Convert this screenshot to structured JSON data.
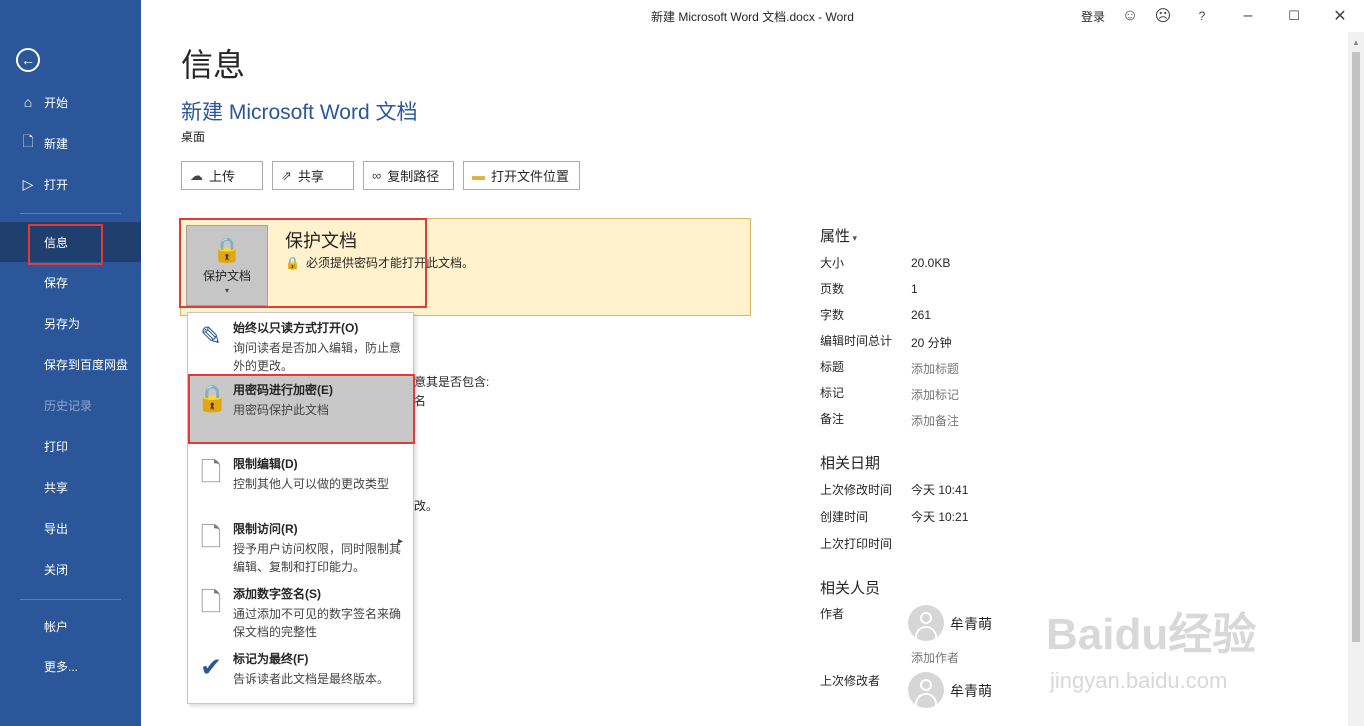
{
  "window": {
    "title": "新建 Microsoft Word 文档.docx  -  Word",
    "signin": "登录",
    "help": "?",
    "icons": [
      "smiley-icon",
      "frown-icon",
      "help-icon",
      "minimize-icon",
      "maximize-icon",
      "close-icon"
    ]
  },
  "sidebar": {
    "back_glyph": "←",
    "items": [
      {
        "label": "开始",
        "icon": "home-icon"
      },
      {
        "label": "新建",
        "icon": "new-document-icon"
      },
      {
        "label": "打开",
        "icon": "open-folder-icon"
      },
      {
        "label": "信息",
        "active": true
      },
      {
        "label": "保存"
      },
      {
        "label": "另存为"
      },
      {
        "label": "保存到百度网盘"
      },
      {
        "label": "历史记录",
        "disabled": true
      },
      {
        "label": "打印"
      },
      {
        "label": "共享"
      },
      {
        "label": "导出"
      },
      {
        "label": "关闭"
      },
      {
        "label": "帐户"
      },
      {
        "label": "更多..."
      }
    ]
  },
  "main": {
    "page_title": "信息",
    "doc_title": "新建 Microsoft Word 文档",
    "doc_location": "桌面",
    "actions": [
      {
        "label": "上传",
        "icon": "cloud-upload-icon"
      },
      {
        "label": "共享",
        "icon": "share-icon"
      },
      {
        "label": "复制路径",
        "icon": "link-icon"
      },
      {
        "label": "打开文件位置",
        "icon": "folder-icon"
      }
    ],
    "protect": {
      "tile_label": "保护文档",
      "heading": "保护文档",
      "description": "必须提供密码才能打开此文档。"
    },
    "menu": [
      {
        "title": "始终以只读方式打开(O)",
        "desc": "询问读者是否加入编辑，防止意外的更改。",
        "icon": "read-only-icon"
      },
      {
        "title": "用密码进行加密(E)",
        "desc": "用密码保护此文档",
        "icon": "encrypt-password-icon",
        "highlighted": true
      },
      {
        "title": "限制编辑(D)",
        "desc": "控制其他人可以做的更改类型",
        "icon": "restrict-editing-icon"
      },
      {
        "title": "限制访问(R)",
        "desc": "授予用户访问权限，同时限制其编辑、复制和打印能力。",
        "icon": "restrict-access-icon",
        "submenu": true
      },
      {
        "title": "添加数字签名(S)",
        "desc": "通过添加不可见的数字签名来确保文档的完整性",
        "icon": "digital-signature-icon"
      },
      {
        "title": "标记为最终(F)",
        "desc": "告诉读者此文档是最终版本。",
        "icon": "mark-final-icon"
      }
    ],
    "partial_texts": [
      "意其是否包含:",
      "名",
      "改。"
    ]
  },
  "properties": {
    "title": "属性",
    "rows": [
      {
        "label": "大小",
        "value": "20.0KB"
      },
      {
        "label": "页数",
        "value": "1"
      },
      {
        "label": "字数",
        "value": "261"
      },
      {
        "label": "编辑时间总计",
        "value": "20 分钟"
      },
      {
        "label": "标题",
        "value": "添加标题",
        "muted": true
      },
      {
        "label": "标记",
        "value": "添加标记",
        "muted": true
      },
      {
        "label": "备注",
        "value": "添加备注",
        "muted": true
      }
    ]
  },
  "dates": {
    "title": "相关日期",
    "rows": [
      {
        "label": "上次修改时间",
        "value": "今天 10:41"
      },
      {
        "label": "创建时间",
        "value": "今天 10:21"
      },
      {
        "label": "上次打印时间",
        "value": ""
      }
    ]
  },
  "people": {
    "title": "相关人员",
    "author_label": "作者",
    "author_name": "牟青萌",
    "add_author": "添加作者",
    "last_modified_label": "上次修改者",
    "last_modified_name": "牟青萌"
  },
  "watermark": {
    "brand": "Baidu经验",
    "url": "jingyan.baidu.com"
  }
}
